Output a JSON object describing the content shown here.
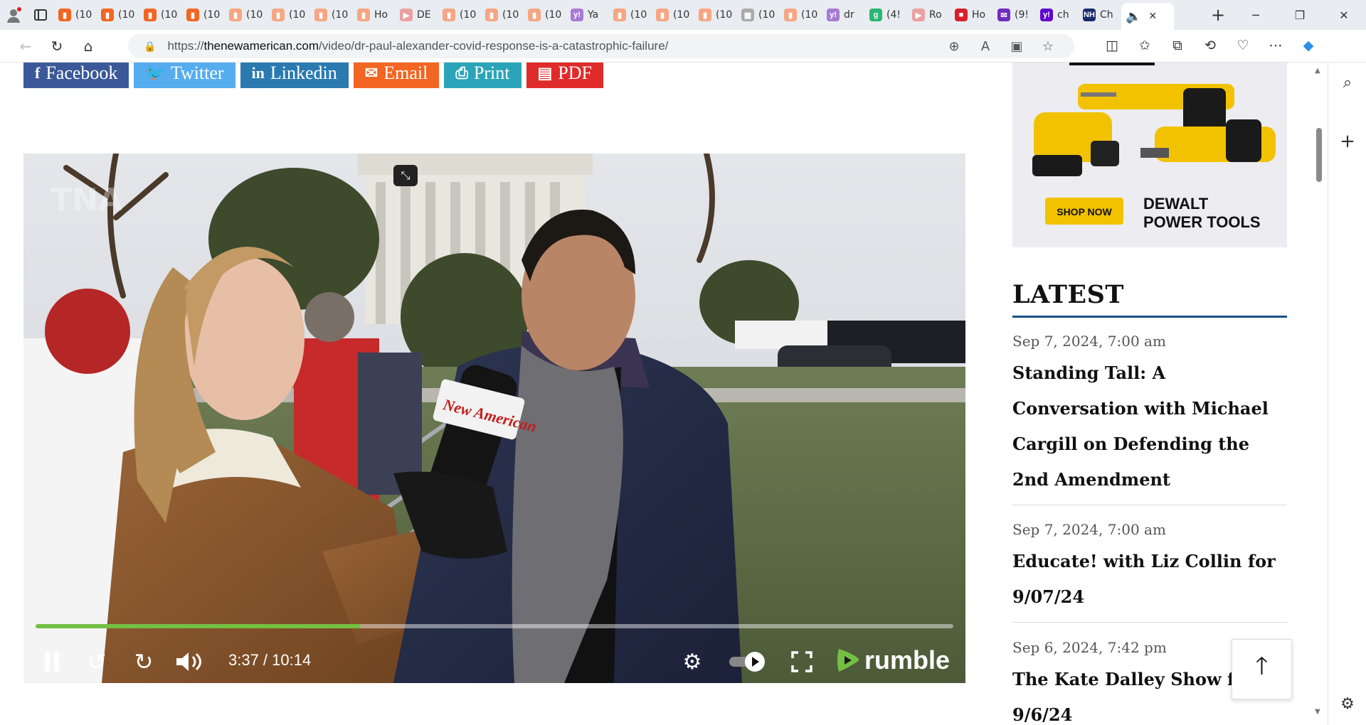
{
  "browser": {
    "tabs": [
      {
        "label": "(10",
        "favicon": "rss-icon",
        "color": "#f26522"
      },
      {
        "label": "(10",
        "favicon": "rss-icon",
        "color": "#f26522"
      },
      {
        "label": "(10",
        "favicon": "rss-icon",
        "color": "#f26522"
      },
      {
        "label": "(10",
        "favicon": "rss-icon",
        "color": "#f26522"
      },
      {
        "label": "(10",
        "favicon": "rss-icon",
        "color": "#f6a684"
      },
      {
        "label": "(10",
        "favicon": "rss-icon",
        "color": "#f6a684"
      },
      {
        "label": "(10",
        "favicon": "rss-icon",
        "color": "#f6a684"
      },
      {
        "label": "Ho",
        "favicon": "rss-icon",
        "color": "#f6a684"
      },
      {
        "label": "DE",
        "favicon": "youtube-icon",
        "color": "#e9a0a0"
      },
      {
        "label": "(10",
        "favicon": "rss-icon",
        "color": "#f6a684"
      },
      {
        "label": "(10",
        "favicon": "rss-icon",
        "color": "#f6a684"
      },
      {
        "label": "(10",
        "favicon": "rss-icon",
        "color": "#f6a684"
      },
      {
        "label": "Ya",
        "favicon": "yahoo-icon",
        "color": "#a77ad6"
      },
      {
        "label": "(10",
        "favicon": "rss-icon",
        "color": "#f6a684"
      },
      {
        "label": "(10",
        "favicon": "rss-icon",
        "color": "#f6a684"
      },
      {
        "label": "(10",
        "favicon": "rss-icon",
        "color": "#f6a684"
      },
      {
        "label": "(10",
        "favicon": "image-icon",
        "color": "#aaaaaa"
      },
      {
        "label": "(10",
        "favicon": "rss-icon",
        "color": "#f6a684"
      },
      {
        "label": "dr",
        "favicon": "yahoo-icon",
        "color": "#a77ad6"
      },
      {
        "label": "(4!",
        "favicon": "grammarly-icon",
        "color": "#2ab673"
      },
      {
        "label": "Ro",
        "favicon": "youtube-icon",
        "color": "#e9a0a0"
      },
      {
        "label": "Ho",
        "favicon": "red-icon",
        "color": "#d81e2b"
      },
      {
        "label": "(9!",
        "favicon": "mail-icon",
        "color": "#6f2dbd"
      },
      {
        "label": "ch",
        "favicon": "yahoo-icon",
        "color": "#5f01d1"
      },
      {
        "label": "Ch",
        "favicon": "nh-icon",
        "color": "#1a2a6c"
      }
    ],
    "active_tab_icon": "speaker-icon",
    "url_prefix": "https://",
    "url_domain": "thenewamerican.com",
    "url_path": "/video/dr-paul-alexander-covid-response-is-a-catastrophic-failure/"
  },
  "share": [
    {
      "label": "Facebook",
      "icon": "facebook-icon",
      "color": "#3b5998",
      "glyph": "f"
    },
    {
      "label": "Twitter",
      "icon": "twitter-icon",
      "color": "#55acee",
      "glyph": "🐦"
    },
    {
      "label": "Linkedin",
      "icon": "linkedin-icon",
      "color": "#2a7ab0",
      "glyph": "in"
    },
    {
      "label": "Email",
      "icon": "email-icon",
      "color": "#f26522",
      "glyph": "✉"
    },
    {
      "label": "Print",
      "icon": "print-icon",
      "color": "#2aa4b8",
      "glyph": "⎙"
    },
    {
      "label": "PDF",
      "icon": "pdf-icon",
      "color": "#e02b2b",
      "glyph": "▤"
    }
  ],
  "video": {
    "time": "3:37 / 10:14",
    "progress": 0.3541,
    "mic_flag": "New American",
    "brand": "rumble",
    "accent": "#74c043"
  },
  "ad": {
    "cta": "SHOP NOW",
    "headline_line1": "DEWALT",
    "headline_line2": "POWER TOOLS"
  },
  "latest": {
    "heading": "LATEST",
    "posts": [
      {
        "date": "Sep 7, 2024, 7:00 am",
        "title": "Standing Tall: A Conversation with Michael Cargill on Defending the 2nd Amendment"
      },
      {
        "date": "Sep 7, 2024, 7:00 am",
        "title": "Educate! with Liz Collin for 9/07/24"
      },
      {
        "date": "Sep 6, 2024, 7:42 pm",
        "title": "The Kate Dalley Show for 9/6/24"
      }
    ]
  }
}
